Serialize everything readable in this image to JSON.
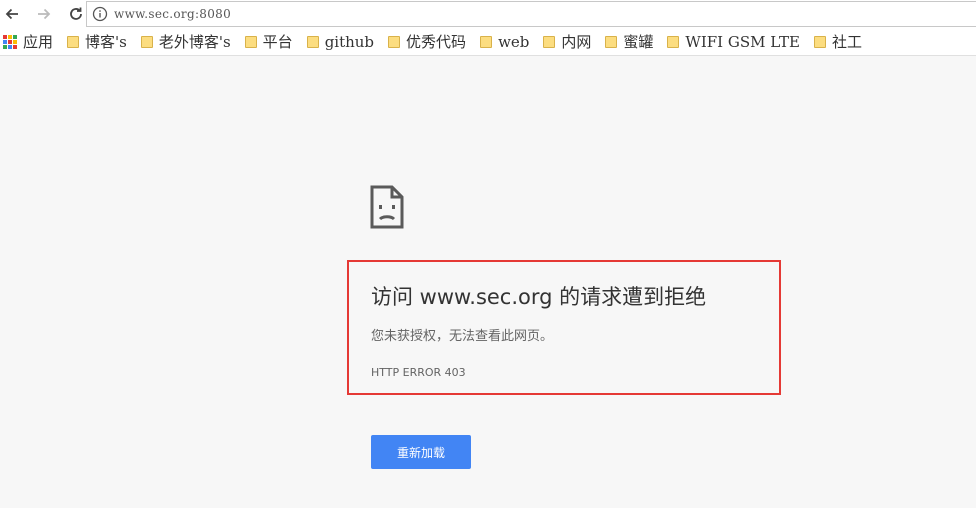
{
  "toolbar": {
    "url": "www.sec.org:8080"
  },
  "bookmarks": [
    "应用",
    "博客's",
    "老外博客's",
    "平台",
    "github",
    "优秀代码",
    "web",
    "内网",
    "蜜罐",
    "WIFI GSM LTE",
    "社工"
  ],
  "error": {
    "headline": "访问 www.sec.org 的请求遭到拒绝",
    "description": "您未获授权，无法查看此网页。",
    "code": "HTTP ERROR 403",
    "reload_label": "重新加载"
  },
  "colors": {
    "accent": "#4285f4",
    "highlight_border": "#e53935",
    "page_bg": "#f7f7f7"
  },
  "icons": {
    "back": "arrow-left-icon",
    "forward": "arrow-right-icon",
    "reload": "refresh-icon",
    "info": "info-icon",
    "apps": "apps-grid-icon",
    "folder": "folder-icon",
    "sad_page": "sad-page-icon"
  }
}
